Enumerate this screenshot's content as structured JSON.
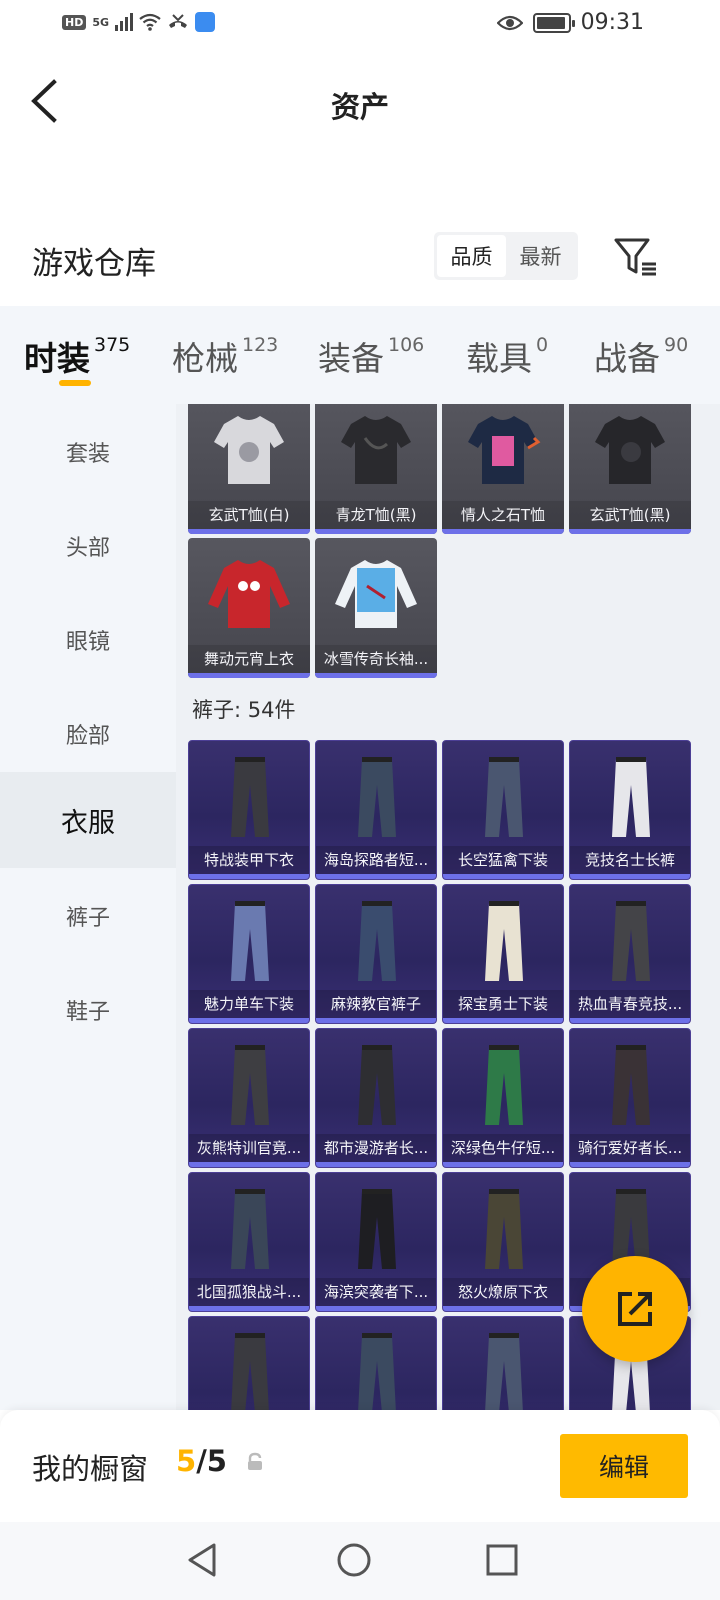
{
  "status_bar": {
    "hd": "HD",
    "network": "5G",
    "time": "09:31"
  },
  "header": {
    "title": "资产"
  },
  "section": {
    "title": "游戏仓库",
    "sort_options": [
      "品质",
      "最新"
    ]
  },
  "tabs": [
    {
      "label": "时装",
      "count": "375"
    },
    {
      "label": "枪械",
      "count": "123"
    },
    {
      "label": "装备",
      "count": "106"
    },
    {
      "label": "载具",
      "count": "0"
    },
    {
      "label": "战备",
      "count": "90"
    }
  ],
  "side_menu": [
    "套装",
    "头部",
    "眼镜",
    "脸部",
    "衣服",
    "裤子",
    "鞋子"
  ],
  "shirts": [
    "玄武T恤(白)",
    "青龙T恤(黑)",
    "情人之石T恤",
    "玄武T恤(黑)",
    "舞动元宵上衣",
    "冰雪传奇长袖..."
  ],
  "pants_group_title": "裤子: 54件",
  "pants": [
    "特战装甲下衣",
    "海岛探路者短...",
    "长空猛禽下装",
    "竞技名士长裤",
    "魅力单车下装",
    "麻辣教官裤子",
    "探宝勇士下装",
    "热血青春竞技...",
    "灰熊特训官竟...",
    "都市漫游者长...",
    "深绿色牛仔短...",
    "骑行爱好者长...",
    "北国孤狼战斗...",
    "海滨突袭者下...",
    "怒火燎原下衣",
    ""
  ],
  "bottom": {
    "label": "我的橱窗",
    "current": "5",
    "separator": "/",
    "max": "5",
    "edit": "编辑"
  },
  "colors": {
    "accent": "#ffb400",
    "card_bar": "#6d70e8"
  }
}
